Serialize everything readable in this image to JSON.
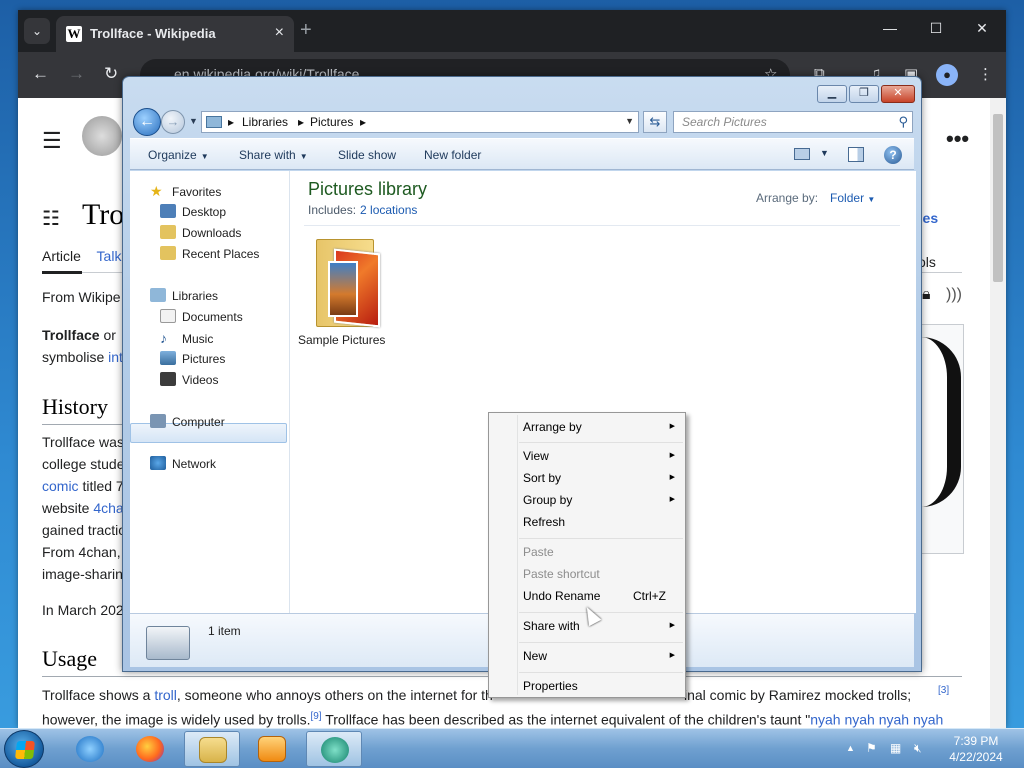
{
  "chrome": {
    "tab_title": "Trollface - Wikipedia",
    "tab_favicon": "W",
    "url": "en.wikipedia.org/wiki/Trollface"
  },
  "wiki": {
    "page_title_visible": "Trol",
    "tabs": [
      "Article",
      "Talk"
    ],
    "from_text": "From Wikipe",
    "lead_bold": "Trollface",
    "lead_rest": " or ",
    "lead_line2": "symbolise ",
    "lead_link": "int",
    "languages_label": "ges",
    "tools_label": "ols",
    "history_heading": "History",
    "history_lines": [
      "Trollface was",
      "college stude",
      "website ",
      "gained tractio",
      "From 4chan,",
      "image-sharin"
    ],
    "history_link_comic": "comic",
    "history_titled": " titled 7",
    "history_link_4chan": "4cha",
    "march_text": "In March 202",
    "usage_heading": "Usage",
    "usage_line1_a": "Trollface shows a ",
    "usage_line1_link": "troll",
    "usage_line1_b": ", someone who annoys others on the internet for th",
    "usage_line1_c": "inal comic by Ramirez mocked trolls;",
    "usage_line1_sup": "[3]",
    "usage_line2_a": "however, the image is widely used by trolls.",
    "usage_line2_sup": "[9]",
    "usage_line2_b": " Trollface has been described as the internet equivalent of the children's taunt \"",
    "usage_line2_link": "nyah nyah nyah nyah"
  },
  "explorer": {
    "breadcrumbs": [
      "Libraries",
      "Pictures"
    ],
    "search_placeholder": "Search Pictures",
    "commands": [
      "Organize",
      "Share with",
      "Slide show",
      "New folder"
    ],
    "nav": {
      "favorites": "Favorites",
      "favorites_items": [
        "Desktop",
        "Downloads",
        "Recent Places"
      ],
      "libraries": "Libraries",
      "libraries_items": [
        "Documents",
        "Music",
        "Pictures",
        "Videos"
      ],
      "computer": "Computer",
      "network": "Network"
    },
    "library_title": "Pictures library",
    "includes_label": "Includes:",
    "includes_link": "2 locations",
    "arrange_label": "Arrange by:",
    "arrange_value": "Folder",
    "items": [
      {
        "name": "Sample Pictures"
      }
    ],
    "status": "1 item"
  },
  "context_menu": {
    "arrange_by": "Arrange by",
    "view": "View",
    "sort_by": "Sort by",
    "group_by": "Group by",
    "refresh": "Refresh",
    "paste": "Paste",
    "paste_shortcut": "Paste shortcut",
    "undo_rename": "Undo Rename",
    "undo_shortcut": "Ctrl+Z",
    "share_with": "Share with",
    "new": "New",
    "properties": "Properties"
  },
  "taskbar": {
    "time": "7:39 PM",
    "date": "4/22/2024"
  }
}
